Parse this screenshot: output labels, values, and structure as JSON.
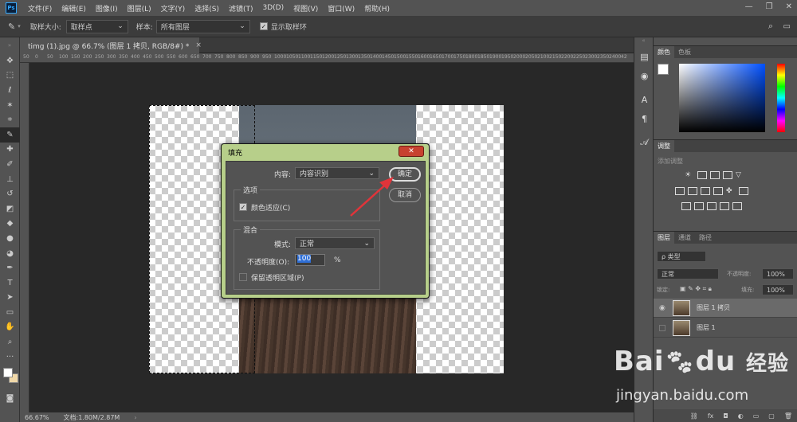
{
  "app": {
    "logo": "Ps",
    "window_controls": [
      "—",
      "❐",
      "✕"
    ]
  },
  "menu": [
    "文件(F)",
    "编辑(E)",
    "图像(I)",
    "图层(L)",
    "文字(Y)",
    "选择(S)",
    "滤镜(T)",
    "3D(D)",
    "视图(V)",
    "窗口(W)",
    "帮助(H)"
  ],
  "options": {
    "sample_size_label": "取样大小:",
    "sample_size_value": "取样点",
    "sample_label": "样本:",
    "sample_value": "所有图层",
    "show_ring_label": "显示取样环"
  },
  "doc_tab": {
    "title": "timg (1).jpg @ 66.7% (图层 1 拷贝, RGB/8#) *",
    "close": "×"
  },
  "ruler_h": [
    "50",
    "0",
    "50",
    "100",
    "150",
    "200",
    "250",
    "300",
    "350",
    "400",
    "450",
    "500",
    "550",
    "600",
    "650",
    "700",
    "750",
    "800",
    "850",
    "900",
    "950",
    "1000",
    "1050",
    "1100",
    "1150",
    "1200",
    "1250",
    "1300",
    "1350",
    "1400",
    "1450",
    "1500",
    "1550",
    "1600",
    "1650",
    "1700",
    "1750",
    "1800",
    "1850",
    "1900",
    "1950",
    "2000",
    "2050",
    "2100",
    "2150",
    "2200",
    "2250",
    "2300",
    "2350",
    "2400",
    "42"
  ],
  "status": {
    "zoom": "66.67%",
    "doc": "文档:1.80M/2.87M"
  },
  "dialog": {
    "title": "填充",
    "close": "✕",
    "content_label": "内容:",
    "content_value": "内容识别",
    "options_legend": "选项",
    "color_adapt_label": "颜色适应(C)",
    "color_adapt_checked": true,
    "blend_legend": "混合",
    "mode_label": "模式:",
    "mode_value": "正常",
    "opacity_label": "不透明度(O):",
    "opacity_value": "100",
    "opacity_unit": "%",
    "preserve_label": "保留透明区域(P)",
    "preserve_checked": false,
    "ok": "确定",
    "cancel": "取消"
  },
  "panels": {
    "color_tabs": [
      "颜色",
      "色板"
    ],
    "adjust_tab": "调整",
    "adjust_add": "添加调整",
    "layers_tabs": [
      "图层",
      "通道",
      "路径"
    ],
    "kind_label": "ρ 类型",
    "blend_mode": "正常",
    "opacity_label": "不透明度:",
    "opacity_value": "100%",
    "lock_label": "锁定:",
    "fill_label": "填充:",
    "fill_value": "100%",
    "layers": [
      {
        "name": "图层 1 拷贝",
        "visible": true,
        "selected": true
      },
      {
        "name": "图层 1",
        "visible": false,
        "selected": false
      }
    ]
  },
  "watermark": {
    "brand": "Bai",
    "brand2": "du",
    "cn": "经验",
    "url": "jingyan.baidu.com"
  },
  "colors": {
    "accent_red": "#e0343a",
    "dialog_frame": "#b7cf8a",
    "ps_blue": "#31a8ff"
  }
}
